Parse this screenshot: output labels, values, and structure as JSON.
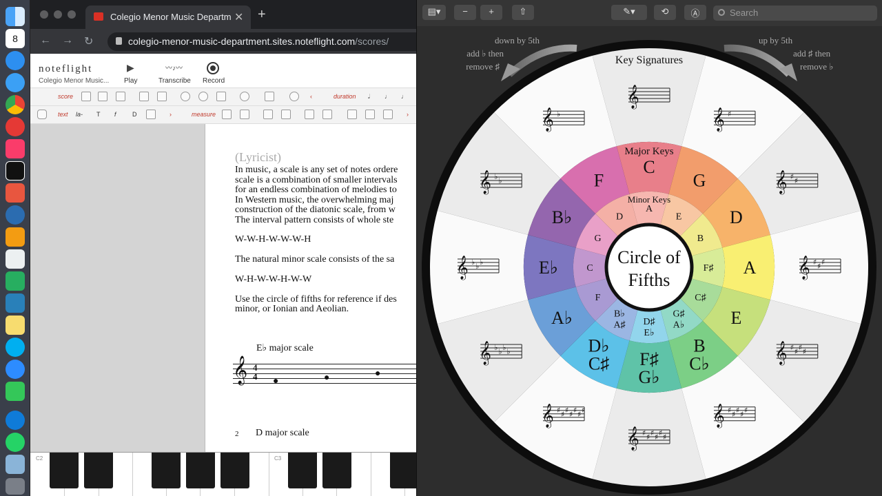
{
  "dock": {
    "apps": [
      "finder-icon",
      "calendar-icon",
      "app-store-icon",
      "safari-icon",
      "chrome-icon",
      "antivirus-icon",
      "music-icon",
      "capcut-icon",
      "fetch-icon",
      "dev-icon",
      "books-icon",
      "textedit-icon",
      "numbers-icon",
      "keynote-icon",
      "notes-icon",
      "skype-icon",
      "zoom-icon",
      "facetime-icon",
      "edge-icon",
      "whatsapp-icon",
      "preview-icon",
      "trash-icon"
    ],
    "calendar_month": "OCT",
    "calendar_day": "8"
  },
  "browser": {
    "tab_title": "Colegio Menor Music Departm",
    "url_host": "colegio-menor-music-department.sites.noteflight.com",
    "url_path": "/scores/"
  },
  "noteflight": {
    "logo": "noteflight",
    "org": "Colegio Menor Music...",
    "play": "Play",
    "transcribe": "Transcribe",
    "record": "Record",
    "tb_score": "score",
    "tb_duration": "duration",
    "tb_text": "text",
    "tb_la": "la-",
    "tb_T": "T",
    "tb_f": "f",
    "tb_measure": "measure",
    "tb_chord_letter": "D"
  },
  "score": {
    "lyricist": "(Lyricist)",
    "lines": [
      "In music, a scale is any set of notes ordere",
      "scale is a combination of smaller intervals",
      "for an endless combination of melodies to",
      "In Western music, the overwhelming maj",
      "construction of the diatonic scale, from w",
      "The interval pattern consists of whole ste"
    ],
    "pattern_major": "W-W-H-W-W-W-H",
    "minor_text": "The natural minor scale consists of the sa",
    "pattern_minor": "W-H-W-W-H-W-W",
    "ref_line1": "Use the circle of fifths for reference if des",
    "ref_line2": "minor, or Ionian and Aeolian.",
    "scale1": "E♭ major scale",
    "measure_num": "2",
    "scale2": "D major scale",
    "time_sig": "4"
  },
  "piano": {
    "c2": "C2",
    "c3": "C3"
  },
  "preview": {
    "search_placeholder": "Search"
  },
  "circle": {
    "title": "Key Signatures",
    "left_note": [
      "down by 5th",
      "add ♭ then",
      "remove ♯"
    ],
    "right_note": [
      "up by 5th",
      "add ♯ then",
      "remove ♭"
    ],
    "major_heading": "Major Keys",
    "minor_heading": "Minor Keys",
    "center": [
      "Circle of",
      "Fifths"
    ],
    "major": [
      "C",
      "G",
      "D",
      "A",
      "E",
      "B\nC♭",
      "F♯\nG♭",
      "D♭\nC♯",
      "A♭",
      "E♭",
      "B♭",
      "F"
    ],
    "minor": [
      "A",
      "E",
      "B",
      "F♯",
      "C♯",
      "G♯\nA♭",
      "D♯\nE♭",
      "B♭\nA♯",
      "F",
      "C",
      "G",
      "D"
    ],
    "colors": [
      "#e87f8a",
      "#f29d6c",
      "#f7b36a",
      "#f9ef72",
      "#c6e07c",
      "#7ccf86",
      "#5fc3a8",
      "#5cc1e8",
      "#6b9fd8",
      "#7d76c0",
      "#9466ae",
      "#d86fae"
    ],
    "minor_colors": [
      "#f6b7b0",
      "#f8c7a3",
      "#f0ea8e",
      "#d8ec98",
      "#a8dc9a",
      "#92d9c6",
      "#92d5ec",
      "#9bb6e3",
      "#a99ad3",
      "#c197ce",
      "#e9a0c8",
      "#f4b0a6"
    ],
    "sharps_flats_per_sector": [
      0,
      1,
      2,
      3,
      4,
      5,
      6,
      7,
      4,
      3,
      2,
      1
    ]
  }
}
